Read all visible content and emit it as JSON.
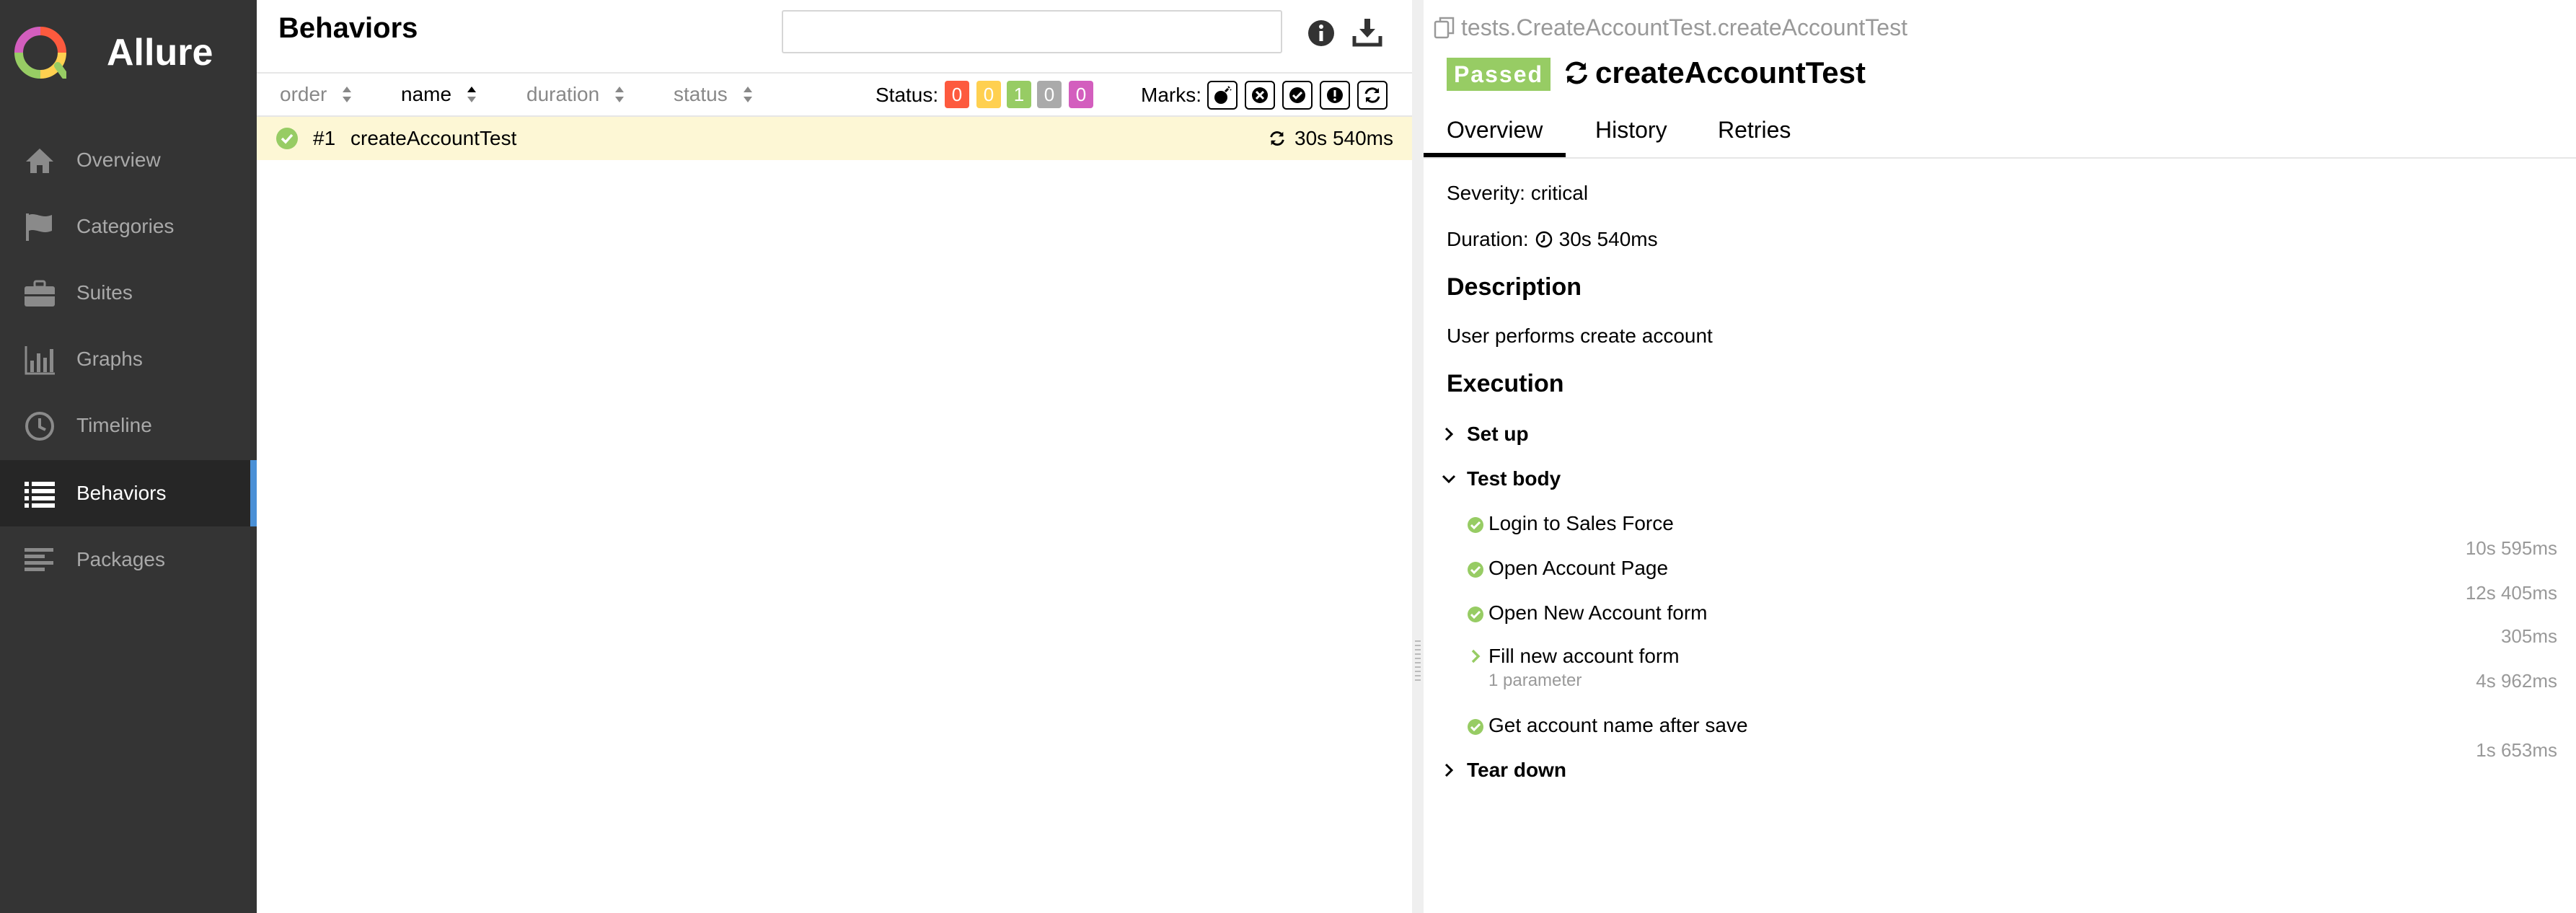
{
  "sidebar": {
    "brand": "Allure",
    "items": [
      {
        "label": "Overview",
        "icon": "home-icon"
      },
      {
        "label": "Categories",
        "icon": "flag-icon"
      },
      {
        "label": "Suites",
        "icon": "briefcase-icon"
      },
      {
        "label": "Graphs",
        "icon": "bar-chart-icon"
      },
      {
        "label": "Timeline",
        "icon": "clock-icon"
      },
      {
        "label": "Behaviors",
        "icon": "list-icon",
        "active": true
      },
      {
        "label": "Packages",
        "icon": "align-left-icon"
      }
    ]
  },
  "list": {
    "title": "Behaviors",
    "search": {
      "value": "",
      "placeholder": ""
    },
    "columns": {
      "order": "order",
      "name": "name",
      "duration": "duration",
      "status": "status"
    },
    "status_label": "Status:",
    "status_counts": [
      {
        "value": "0",
        "color": "#fd5a3e"
      },
      {
        "value": "0",
        "color": "#ffd050"
      },
      {
        "value": "1",
        "color": "#97cc64"
      },
      {
        "value": "0",
        "color": "#aaaaaa"
      },
      {
        "value": "0",
        "color": "#d35ebe"
      }
    ],
    "marks_label": "Marks:",
    "marks": [
      "flaky-icon",
      "new-failed-icon",
      "new-passed-icon",
      "new-broken-icon",
      "retries-icon"
    ],
    "row": {
      "num": "#1",
      "name": "createAccountTest",
      "duration": "30s 540ms"
    }
  },
  "detail": {
    "path": "tests.CreateAccountTest.createAccountTest",
    "status": "Passed",
    "title": "createAccountTest",
    "tabs": [
      "Overview",
      "History",
      "Retries"
    ],
    "severity": "Severity: critical",
    "duration_label": "Duration:",
    "duration": "30s 540ms",
    "description_heading": "Description",
    "description": "User performs create account",
    "execution_heading": "Execution",
    "setup": "Set up",
    "test_body": "Test body",
    "teardown": "Tear down",
    "steps": [
      {
        "name": "Login to Sales Force",
        "duration": "10s 595ms"
      },
      {
        "name": "Open Account Page",
        "duration": "12s 405ms"
      },
      {
        "name": "Open New Account form",
        "duration": "305ms"
      },
      {
        "name": "Fill new account form",
        "sub": "1 parameter",
        "duration": "4s 962ms"
      },
      {
        "name": "Get account name after save",
        "duration": "1s 653ms"
      }
    ]
  },
  "colors": {
    "sidebar_bg": "#343434",
    "active_indicator": "#4a90d6",
    "passed": "#97cc64",
    "selected_row": "#fdf7d5"
  }
}
